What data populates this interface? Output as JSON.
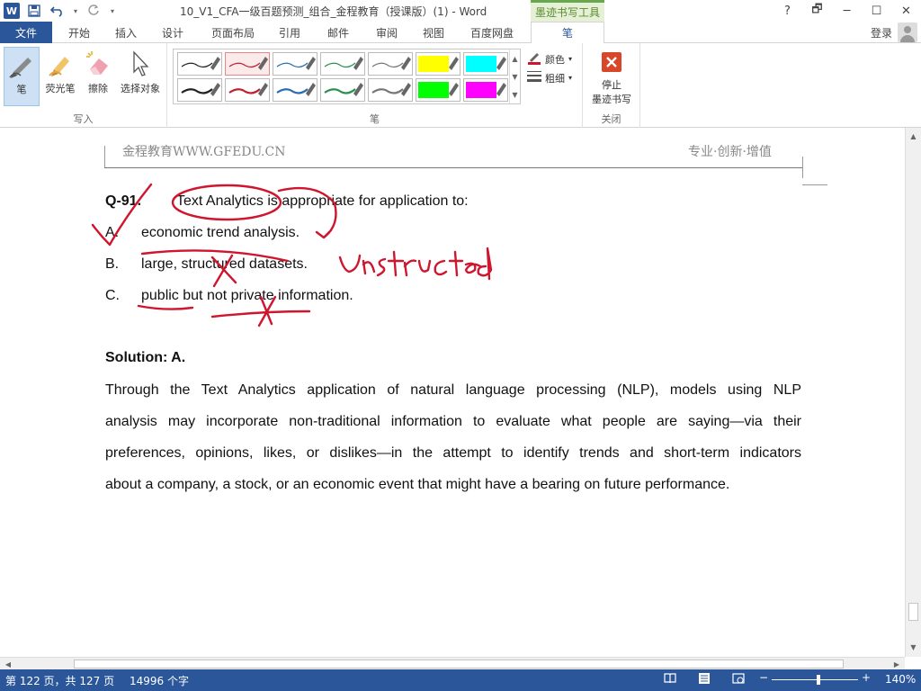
{
  "titlebar": {
    "doc_title": "10_V1_CFA一级百题预测_组合_金程教育（授课版）(1) - Word",
    "contextual_tool": "墨迹书写工具",
    "help": "?",
    "restore": "🗗",
    "minimize": "─",
    "maximize": "☐",
    "close": "✕"
  },
  "tabs": {
    "file": "文件",
    "home": "开始",
    "insert": "插入",
    "design": "设计",
    "layout": "页面布局",
    "references": "引用",
    "mailings": "邮件",
    "review": "审阅",
    "view": "视图",
    "baidu": "百度网盘",
    "pen": "笔",
    "login": "登录"
  },
  "ribbon": {
    "write_group": {
      "label": "写入",
      "pen": "笔",
      "highlighter": "荧光笔",
      "eraser": "擦除",
      "select": "选择对象"
    },
    "pen_group": {
      "label": "笔"
    },
    "color": "颜色",
    "thickness": "粗细",
    "close_group": {
      "label": "关闭",
      "stop_line1": "停止",
      "stop_line2": "墨迹书写"
    },
    "colors": {
      "row1": [
        "#222222",
        "#c02030",
        "#2a6db0",
        "#2a9050",
        "#777777",
        "#ffff00",
        "#00ffff"
      ],
      "row2": [
        "#222222",
        "#c02030",
        "#2a6db0",
        "#2a9050",
        "#777777",
        "#00ff00",
        "#ff00ff"
      ]
    }
  },
  "document": {
    "header_left": "金程教育WWW.GFEDU.CN",
    "header_right": "专业·创新·增值",
    "question_no": "Q-91.",
    "question": "Text Analytics is appropriate for application to:",
    "options": [
      {
        "letter": "A.",
        "text": "economic trend analysis."
      },
      {
        "letter": "B.",
        "text": "large, structured datasets."
      },
      {
        "letter": "C.",
        "text": "public but not private information."
      }
    ],
    "solution": "Solution: A.",
    "explanation": [
      "Through the Text Analytics application of natural language processing (NLP), models using NLP",
      "analysis may incorporate non-traditional information to evaluate what people are saying—via their",
      "preferences, opinions, likes, or dislikes—in the attempt to identify trends and short-term indicators",
      "about a company, a stock, or an economic event that might have a bearing on future performance."
    ],
    "ink_color": "#d0152e"
  },
  "statusbar": {
    "page": "第 122 页，共 127 页",
    "words": "14996 个字",
    "zoom": "140%",
    "zoom_level_percent": 140
  }
}
